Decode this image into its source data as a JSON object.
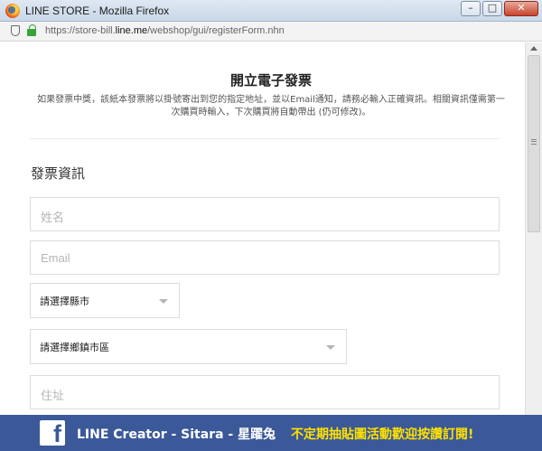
{
  "window": {
    "title": "LINE STORE - Mozilla Firefox",
    "min_label": "–",
    "max_label": "□",
    "close_label": "✕"
  },
  "address_bar": {
    "url_prefix": "https://store-bill.",
    "url_domain": "line.me",
    "url_path": "/webshop/gui/registerForm.nhn"
  },
  "page": {
    "heading": "開立電子發票",
    "description": "如果發票中獎，該紙本發票將以掛號寄出到您的指定地址，並以Email通知，請務必輸入正確資訊。相關資訊僅需第一次購買時輸入，下次購買將自動帶出 (仍可修改)。",
    "section_title": "發票資訊"
  },
  "form": {
    "name_placeholder": "姓名",
    "email_placeholder": "Email",
    "city_select": "請選擇縣市",
    "district_select": "請選擇鄉鎮市區",
    "address_placeholder": "住址"
  },
  "banner": {
    "title": "LINE Creator - Sitara - 星躍兔",
    "promo": "不定期抽貼圖活動歡迎按讚訂閱!",
    "fb_letter": "f"
  },
  "colors": {
    "banner_bg": "#3b5998",
    "promo_text": "#ffe100",
    "lock_green": "#39a338"
  },
  "icons": [
    "firefox-icon",
    "shield-icon",
    "lock-icon",
    "facebook-icon",
    "chevron-down-icon"
  ]
}
